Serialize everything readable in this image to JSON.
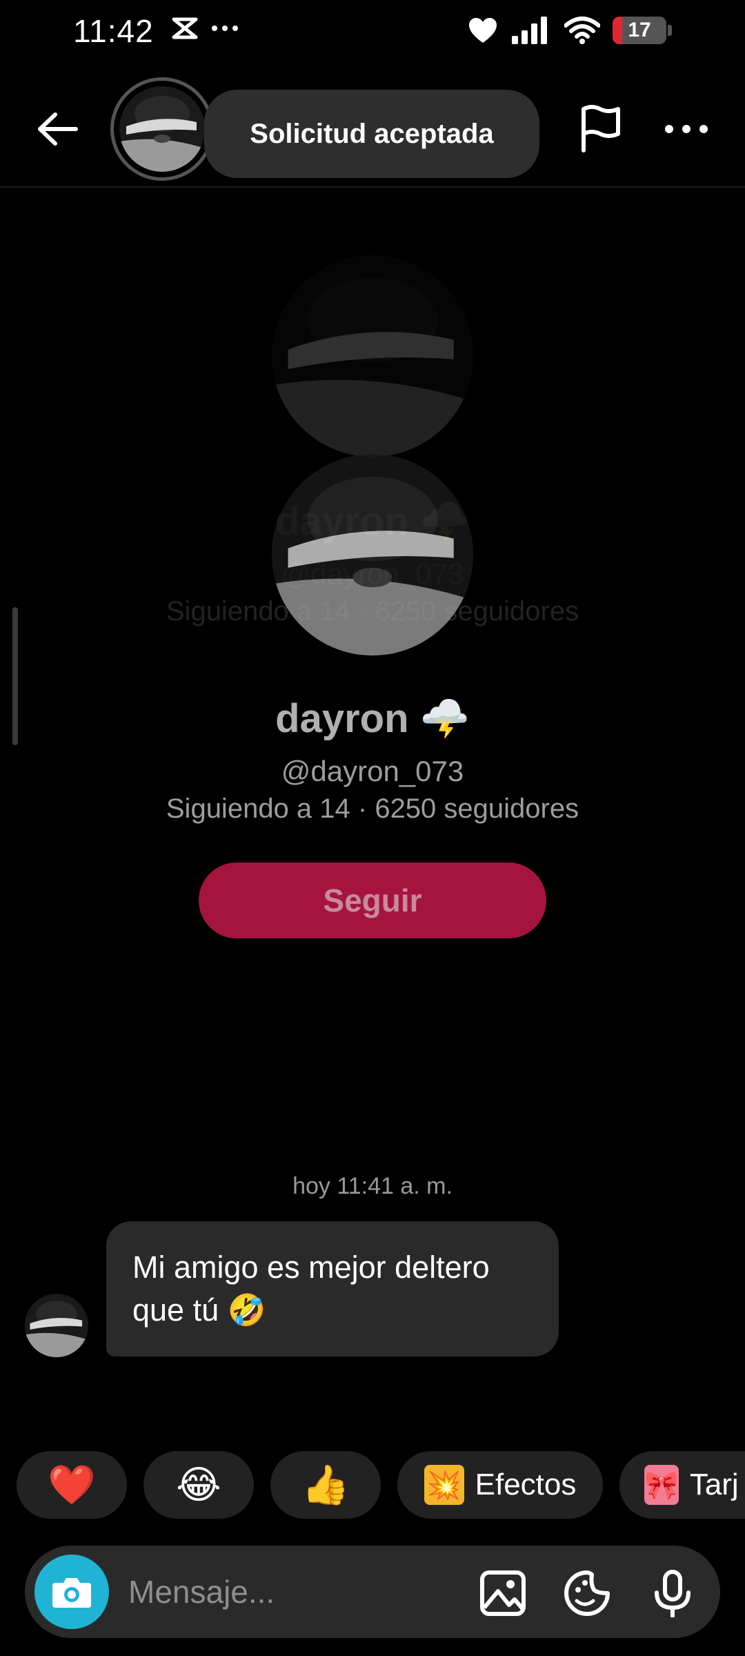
{
  "status_bar": {
    "time": "11:42",
    "battery": "17",
    "icons": [
      "capcut-icon",
      "more-dots-icon",
      "heart-icon",
      "signal-icon",
      "wifi-icon",
      "battery-icon"
    ]
  },
  "header": {
    "toast": "Solicitud aceptada"
  },
  "profile": {
    "name": "dayron",
    "name_emoji": "🌩️",
    "handle": "@dayron_073",
    "stats": "Siguiendo a 14 · 6250 seguidores",
    "follow_label": "Seguir"
  },
  "chat": {
    "timestamp": "hoy 11:41 a. m.",
    "messages": [
      {
        "text_line1": "Mi amigo es mejor deltero",
        "text_line2": "que tú 🤣"
      }
    ]
  },
  "quick_replies": [
    {
      "emoji": "❤️"
    },
    {
      "emoji": "😂"
    },
    {
      "emoji": "👍"
    },
    {
      "emoji": "💥",
      "label": "Efectos"
    },
    {
      "emoji": "🎀",
      "label": "Tarj"
    }
  ],
  "input": {
    "placeholder": "Mensaje..."
  },
  "colors": {
    "accent_follow": "#a5143f",
    "camera": "#20b4d4",
    "background": "#000000"
  }
}
